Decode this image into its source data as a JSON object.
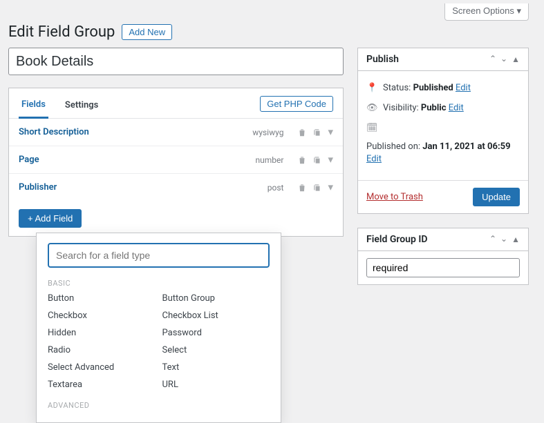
{
  "screen_options_label": "Screen Options ▾",
  "header": {
    "title": "Edit Field Group",
    "add_new_label": "Add New"
  },
  "title_field": {
    "value": "Book Details"
  },
  "tabs": {
    "fields": "Fields",
    "settings": "Settings",
    "php_btn": "Get PHP Code"
  },
  "fields": [
    {
      "title": "Short Description",
      "type": "wysiwyg"
    },
    {
      "title": "Page",
      "type": "number"
    },
    {
      "title": "Publisher",
      "type": "post"
    }
  ],
  "add_field_label": "+ Add Field",
  "dropdown": {
    "search_placeholder": "Search for a field type",
    "groups": {
      "basic_label": "BASIC",
      "basic_items": [
        "Button",
        "Button Group",
        "Checkbox",
        "Checkbox List",
        "Hidden",
        "Password",
        "Radio",
        "Select",
        "Select Advanced",
        "Text",
        "Textarea",
        "URL"
      ],
      "advanced_label": "ADVANCED"
    }
  },
  "sidebar": {
    "publish": {
      "title": "Publish",
      "status_label": "Status:",
      "status_value": "Published",
      "visibility_label": "Visibility:",
      "visibility_value": "Public",
      "published_label": "Published on:",
      "published_value": "Jan 11, 2021 at 06:59",
      "edit_label": "Edit",
      "trash_label": "Move to Trash",
      "update_label": "Update"
    },
    "field_group_id": {
      "title": "Field Group ID",
      "value": "required"
    }
  }
}
